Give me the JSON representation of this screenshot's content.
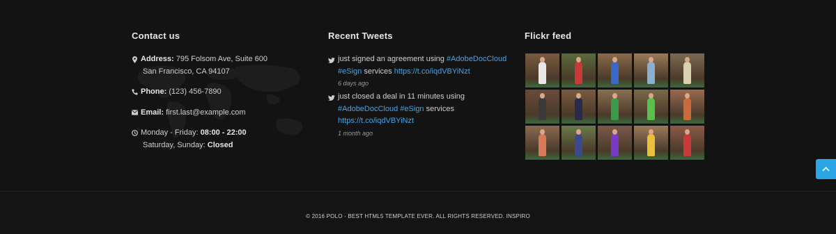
{
  "contact": {
    "title": "Contact us",
    "address_label": "Address:",
    "address_line1": "795 Folsom Ave, Suite 600",
    "address_line2": "San Francisco, CA 94107",
    "phone_label": "Phone:",
    "phone": "(123) 456-7890",
    "email_label": "Email:",
    "email": "first.last@example.com",
    "hours_line1_text": "Monday - Friday:",
    "hours_line1_value": "08:00 - 22:00",
    "hours_line2_text": "Saturday, Sunday:",
    "hours_line2_value": "Closed"
  },
  "tweets": {
    "title": "Recent Tweets",
    "items": [
      {
        "text1": "just signed an agreement using",
        "tag1": "#AdobeDocCloud",
        "tag2": "#eSign",
        "text2": "services",
        "url": "https://t.co/iqdVBYiNzt",
        "time": "6 days ago"
      },
      {
        "text1": "just closed a deal in 11 minutes using",
        "tag1": "#AdobeDocCloud",
        "tag2": "#eSign",
        "text2": "services",
        "url": "https://t.co/iqdVBYiNzt",
        "time": "1 month ago"
      }
    ]
  },
  "flickr": {
    "title": "Flickr feed",
    "thumbs": [
      {
        "bg": "#7a5a3e",
        "fig": "#e8e8e8"
      },
      {
        "bg": "#5a6a3a",
        "fig": "#c83a3a"
      },
      {
        "bg": "#8a6a4a",
        "fig": "#3a6ac8"
      },
      {
        "bg": "#9a7a5a",
        "fig": "#8ab0d0"
      },
      {
        "bg": "#7a6a50",
        "fig": "#d8d0b0"
      },
      {
        "bg": "#6a4a3a",
        "fig": "#3a3a3a"
      },
      {
        "bg": "#7a5a40",
        "fig": "#2a2a4a"
      },
      {
        "bg": "#8a7050",
        "fig": "#3a9a4a"
      },
      {
        "bg": "#7a6a4a",
        "fig": "#5ac04a"
      },
      {
        "bg": "#9a6a50",
        "fig": "#c86a3a"
      },
      {
        "bg": "#8a6a50",
        "fig": "#d87a5a"
      },
      {
        "bg": "#6a7a4a",
        "fig": "#3a4a8a"
      },
      {
        "bg": "#7a5a4a",
        "fig": "#7a3ac8"
      },
      {
        "bg": "#9a7a5a",
        "fig": "#e8c03a"
      },
      {
        "bg": "#8a5a4a",
        "fig": "#c83a3a"
      }
    ]
  },
  "copyright": "© 2016 POLO - BEST HTML5 TEMPLATE EVER. ALL RIGHTS RESERVED. INSPIRO",
  "colors": {
    "accent": "#2aa6e6",
    "link": "#3fa6e8",
    "background": "#141414"
  },
  "icons": {
    "address": "map-marker-icon",
    "phone": "phone-icon",
    "email": "envelope-icon",
    "hours": "clock-icon",
    "tweet": "twitter-icon",
    "scroll": "chevron-up-icon"
  }
}
